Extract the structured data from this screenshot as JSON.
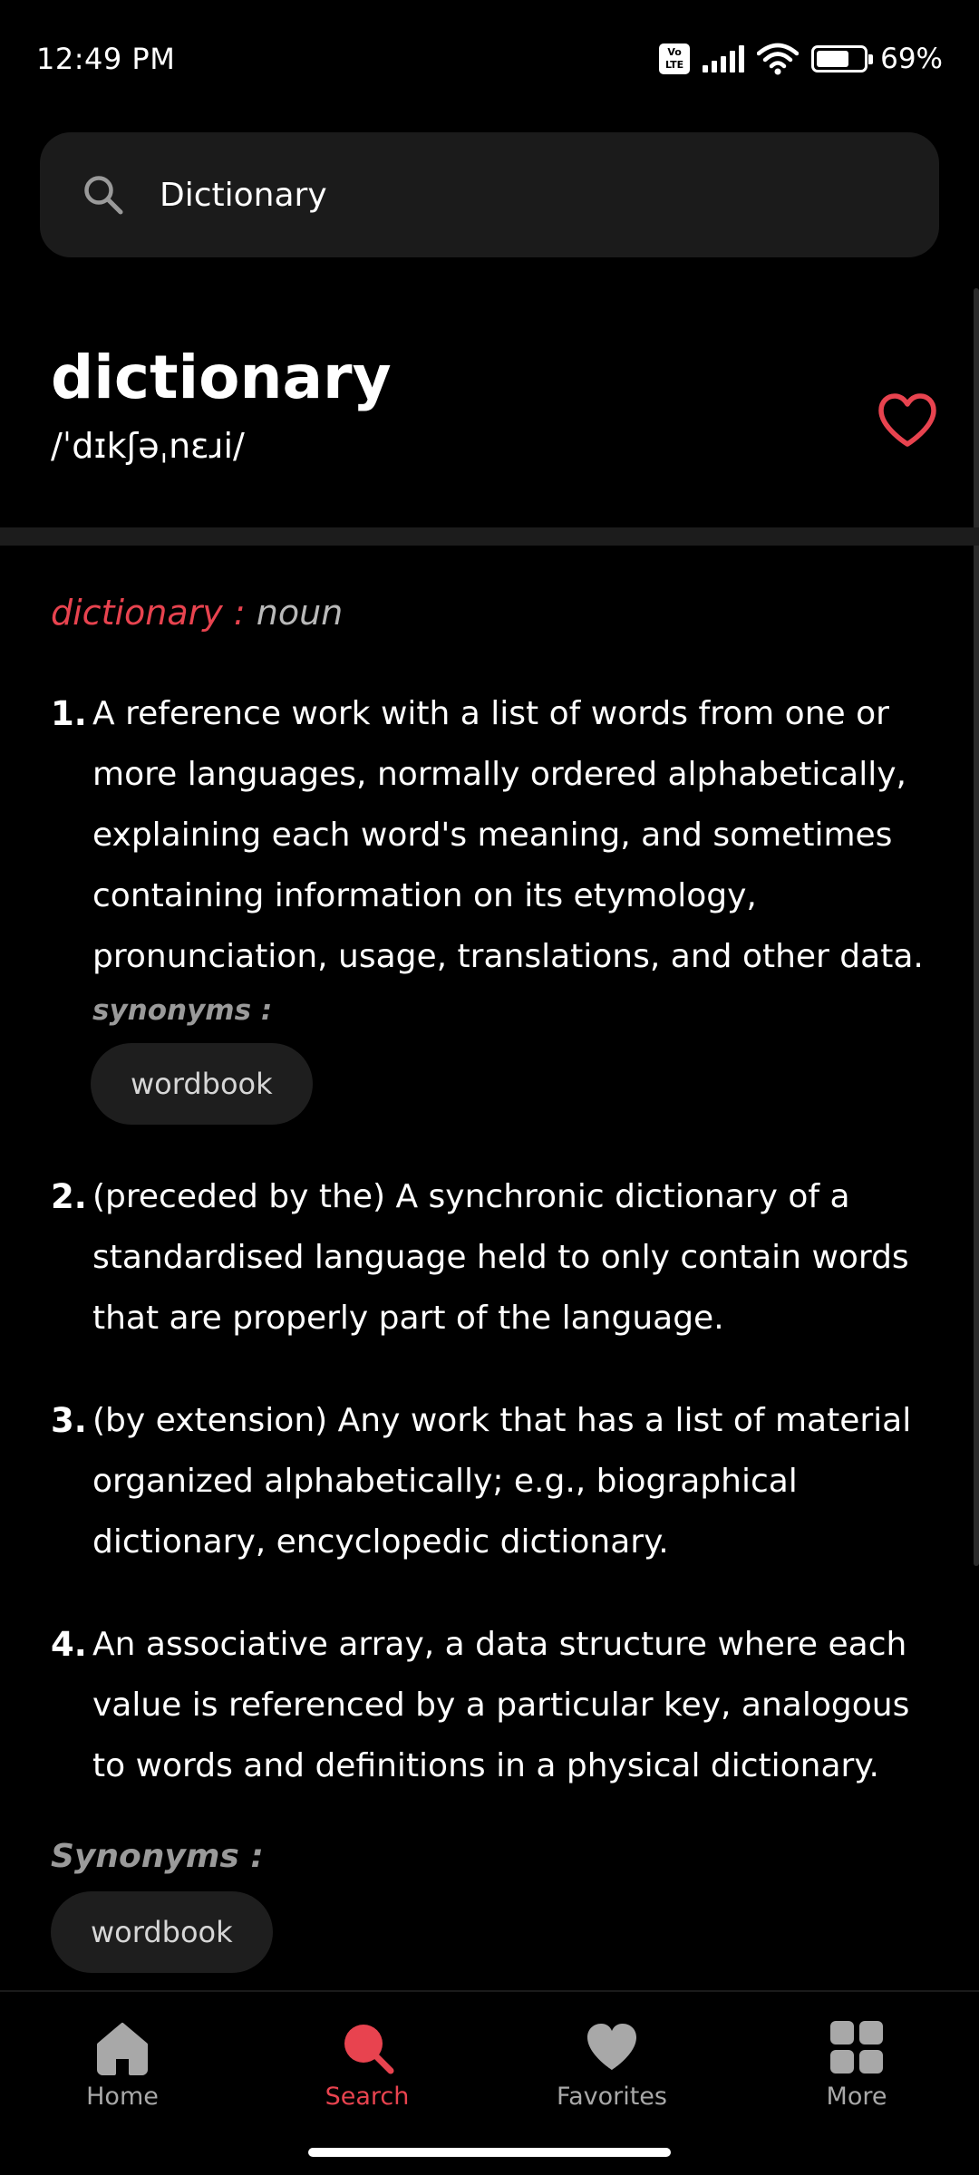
{
  "status_bar": {
    "time": "12:49 PM",
    "volte_line1": "Vo",
    "volte_line2": "LTE",
    "battery_percent": "69%",
    "battery_level": 0.69
  },
  "search": {
    "value": "Dictionary",
    "placeholder": "Search"
  },
  "word": {
    "title": "dictionary",
    "phonetic": "/ˈdɪkʃəˌnɛɹi/",
    "favorite_icon": "heart-outline-icon",
    "accent_color": "#e8434f"
  },
  "entry": {
    "word": "dictionary",
    "separator": " : ",
    "part_of_speech": "noun"
  },
  "definitions": [
    {
      "number": "1.",
      "text": "A reference work with a list of words from one or more languages, normally ordered alphabetically, explaining each word's meaning, and sometimes containing information on its etymology, pronunciation, usage, translations, and other data.",
      "synonyms_label": "synonyms :",
      "synonyms": [
        "wordbook"
      ]
    },
    {
      "number": "2.",
      "text": "(preceded by the) A synchronic dictionary of a standardised language held to only contain words that are properly part of the language."
    },
    {
      "number": "3.",
      "text": "(by extension) Any work that has a list of material organized alphabetically; e.g., biographical dictionary, encyclopedic dictionary."
    },
    {
      "number": "4.",
      "text": "An associative array, a data structure where each value is referenced by a particular key, analogous to words and definitions in a physical dictionary."
    }
  ],
  "synonyms_section": {
    "title": "Synonyms :",
    "items": [
      "wordbook"
    ]
  },
  "nav": {
    "items": [
      {
        "label": "Home",
        "icon": "home-icon",
        "active": false
      },
      {
        "label": "Search",
        "icon": "search-icon",
        "active": true
      },
      {
        "label": "Favorites",
        "icon": "heart-icon",
        "active": false
      },
      {
        "label": "More",
        "icon": "grid-icon",
        "active": false
      }
    ]
  }
}
